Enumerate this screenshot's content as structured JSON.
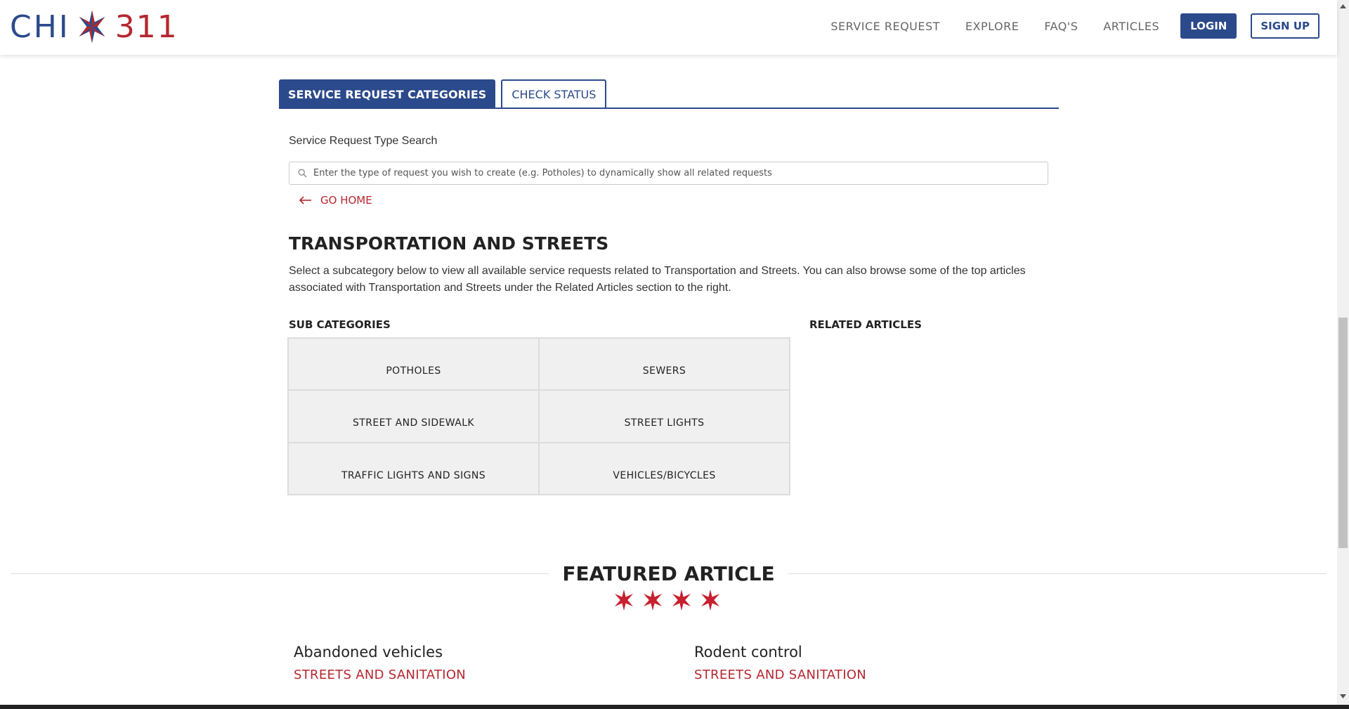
{
  "header": {
    "logo_left": "CHI",
    "logo_right": "311",
    "nav": [
      "SERVICE REQUEST",
      "EXPLORE",
      "FAQ'S",
      "ARTICLES"
    ],
    "login": "LOGIN",
    "signup": "SIGN UP"
  },
  "tabs": {
    "categories": "SERVICE REQUEST CATEGORIES",
    "status": "CHECK STATUS"
  },
  "search": {
    "label": "Service Request Type Search",
    "placeholder": "Enter the type of request you wish to create (e.g. Potholes) to dynamically show all related requests",
    "value": ""
  },
  "go_home": "GO HOME",
  "section": {
    "title": "TRANSPORTATION AND STREETS",
    "description": "Select a subcategory below to view all available service requests related to Transportation and Streets. You can also browse some of the top articles associated with Transportation and Streets under the Related Articles section to the right."
  },
  "subcategories": {
    "title": "SUB CATEGORIES",
    "items": [
      "POTHOLES",
      "SEWERS",
      "STREET AND SIDEWALK",
      "STREET LIGHTS",
      "TRAFFIC LIGHTS AND SIGNS",
      "VEHICLES/BICYCLES"
    ]
  },
  "related_articles": {
    "title": "RELATED ARTICLES"
  },
  "featured": {
    "title": "FEATURED ARTICLE",
    "articles": [
      {
        "title": "Abandoned vehicles",
        "category": "STREETS AND SANITATION"
      },
      {
        "title": "Rodent control",
        "category": "STREETS AND SANITATION"
      }
    ]
  },
  "colors": {
    "brand_blue": "#2b4a8b",
    "brand_red": "#b5272f"
  }
}
